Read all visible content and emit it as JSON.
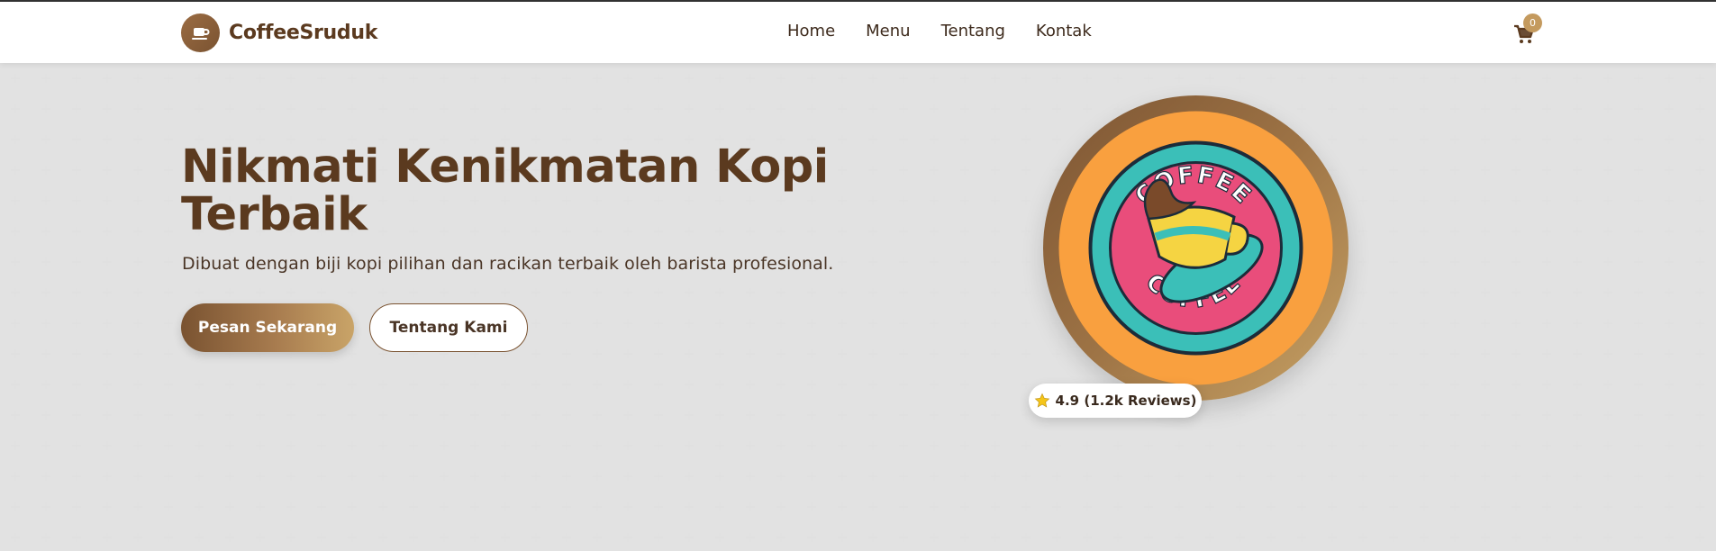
{
  "brand": {
    "name": "CoffeeSruduk",
    "icon": "coffee-cup-icon"
  },
  "nav": {
    "links": [
      "Home",
      "Menu",
      "Tentang",
      "Kontak"
    ]
  },
  "cart": {
    "icon": "shopping-cart-icon",
    "count": "0"
  },
  "hero": {
    "title": "Nikmati Kenikmatan Kopi Terbaik",
    "subtitle": "Dibuat dengan biji kopi pilihan dan racikan terbaik oleh barista profesional.",
    "primary_button": "Pesan Sekarang",
    "secondary_button": "Tentang Kami"
  },
  "logo": {
    "text": "COFFEE"
  },
  "rating": {
    "icon": "star-icon",
    "text": "4.9 (1.2k Reviews)"
  },
  "colors": {
    "brand_brown": "#5b3a1f",
    "accent_gold": "#c49a5e",
    "logo_orange": "#f9a03f",
    "logo_teal": "#3bbfb8",
    "logo_pink": "#e94d7b"
  }
}
